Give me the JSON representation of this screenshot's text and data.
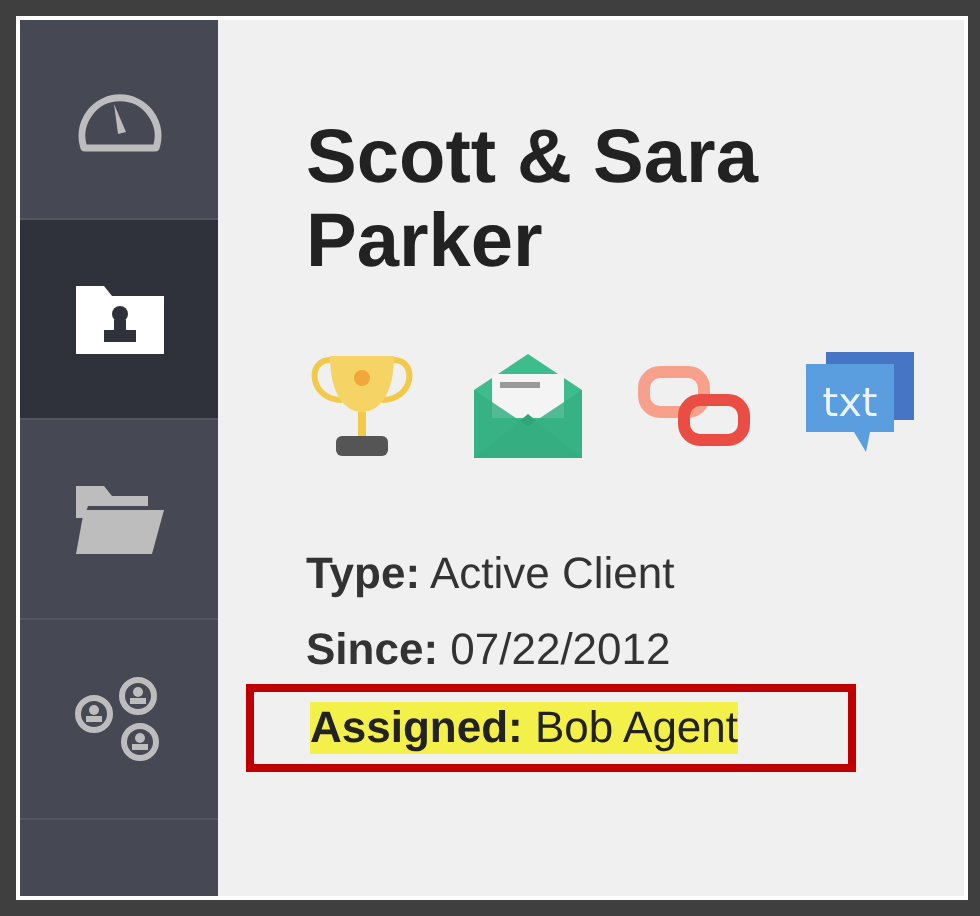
{
  "sidebar": {
    "items": [
      {
        "selected": false
      },
      {
        "selected": true
      },
      {
        "selected": false
      },
      {
        "selected": false
      }
    ]
  },
  "contact": {
    "name": "Scott & Sara Parker"
  },
  "text_icon_label": "txt",
  "details": [
    {
      "label": "Type:",
      "value": "Active Client",
      "highlighted": false
    },
    {
      "label": "Since:",
      "value": "07/22/2012",
      "highlighted": false
    },
    {
      "label": "Assigned:",
      "value": "Bob Agent",
      "highlighted": true
    }
  ]
}
